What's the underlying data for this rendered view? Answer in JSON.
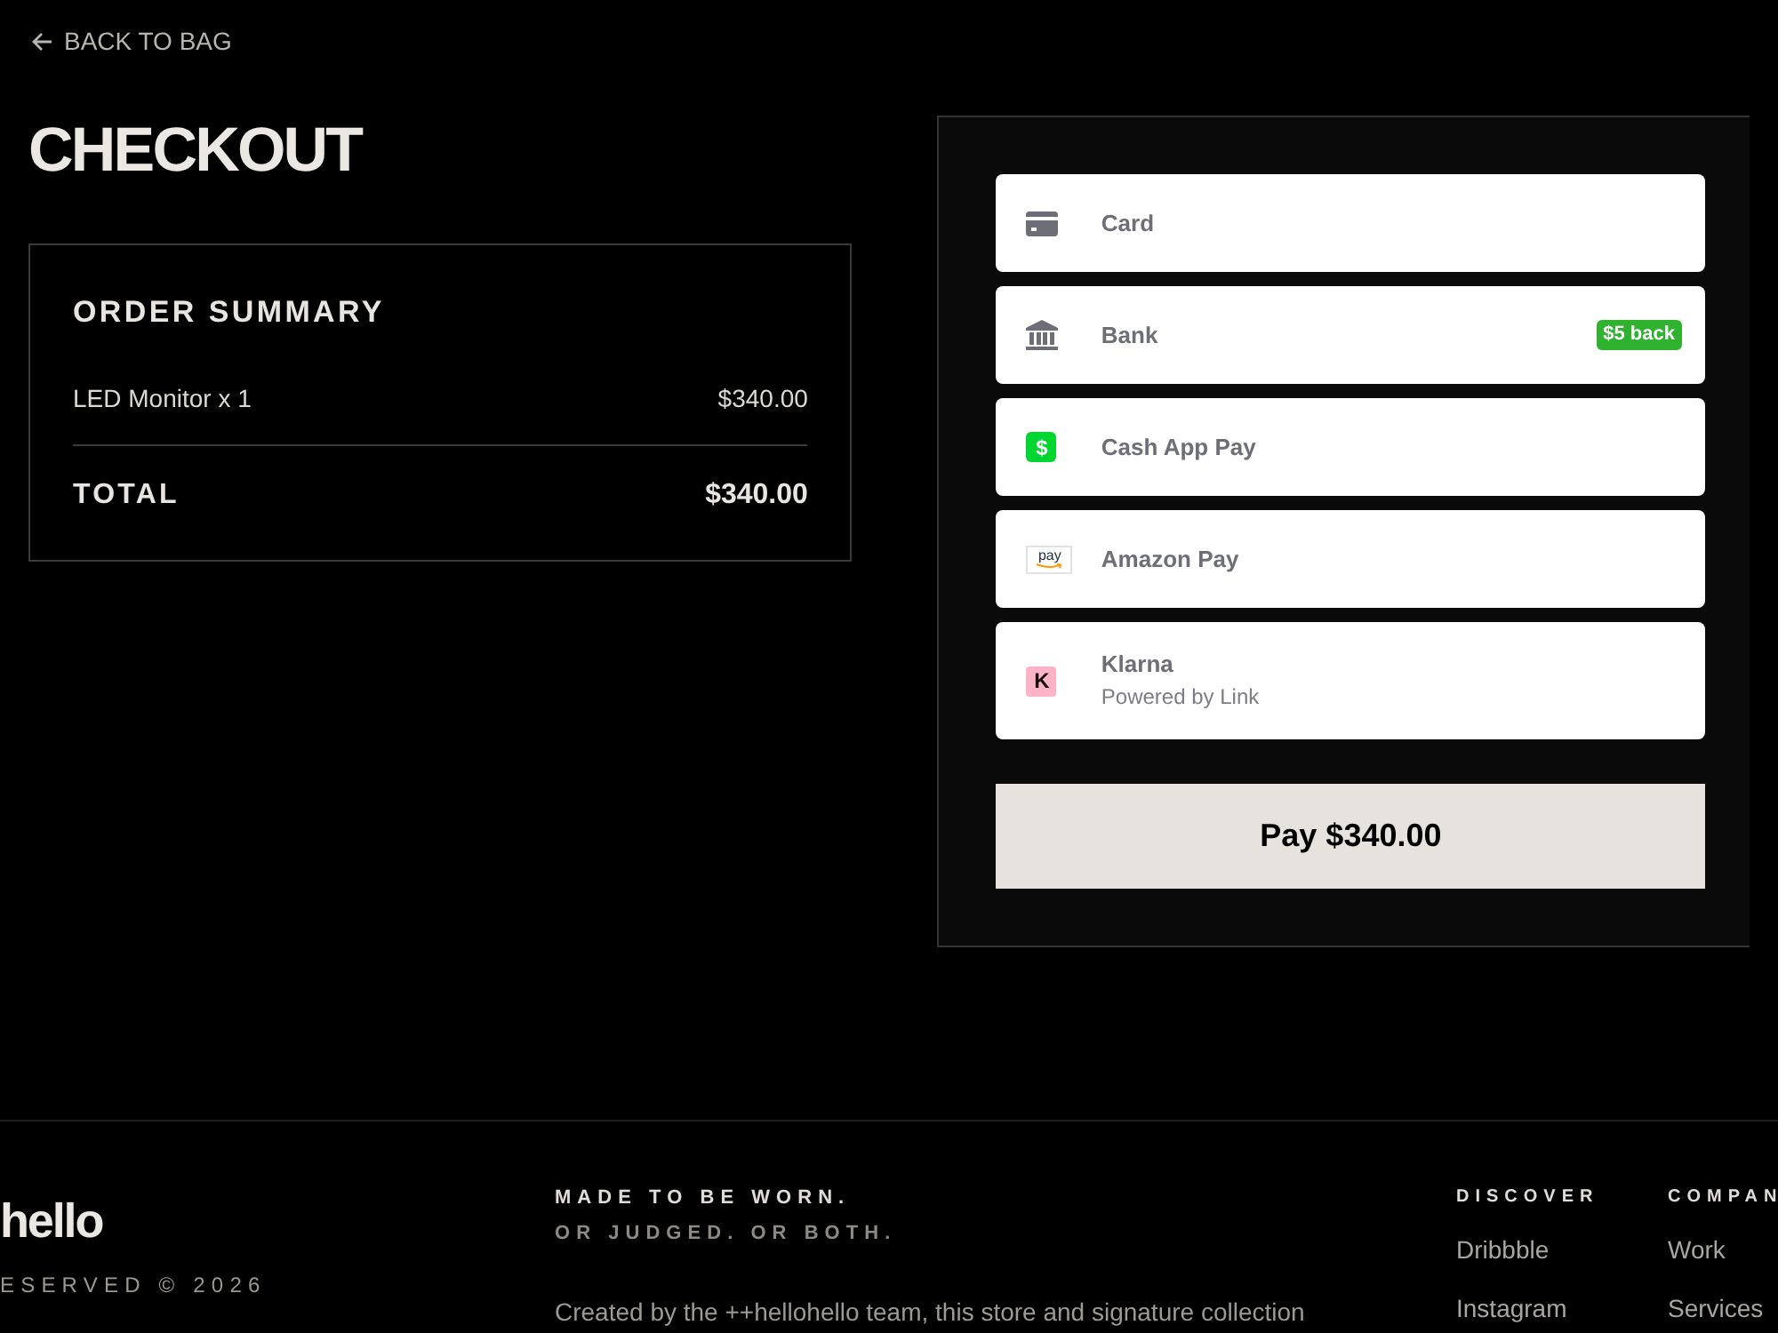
{
  "back_link": {
    "label": "BACK TO BAG"
  },
  "title": "CHECKOUT",
  "order_summary": {
    "heading": "ORDER SUMMARY",
    "items": [
      {
        "name": "LED Monitor x 1",
        "price": "$340.00"
      }
    ],
    "total": {
      "label": "TOTAL",
      "amount": "$340.00"
    }
  },
  "payment_methods": [
    {
      "kind": "card",
      "label": "Card"
    },
    {
      "kind": "bank",
      "label": "Bank",
      "badge": "$5 back"
    },
    {
      "kind": "cashapp",
      "label": "Cash App Pay",
      "logo_text": "$"
    },
    {
      "kind": "amazon",
      "label": "Amazon Pay",
      "logo_text": "pay"
    },
    {
      "kind": "klarna",
      "label": "Klarna",
      "sublabel": "Powered by Link",
      "logo_text": "K"
    }
  ],
  "pay_button": {
    "label": "Pay $340.00"
  },
  "footer": {
    "logo": "hello",
    "copyright": "ESERVED © 2026",
    "tagline": [
      "MADE TO BE WORN.",
      "OR JUDGED. OR BOTH."
    ],
    "description": "Created by the ++hellohello team, this store and signature collection",
    "columns": [
      {
        "heading": "DISCOVER",
        "links": [
          "Dribbble",
          "Instagram"
        ]
      },
      {
        "heading": "COMPAN",
        "links": [
          "Work",
          "Services"
        ]
      }
    ]
  }
}
